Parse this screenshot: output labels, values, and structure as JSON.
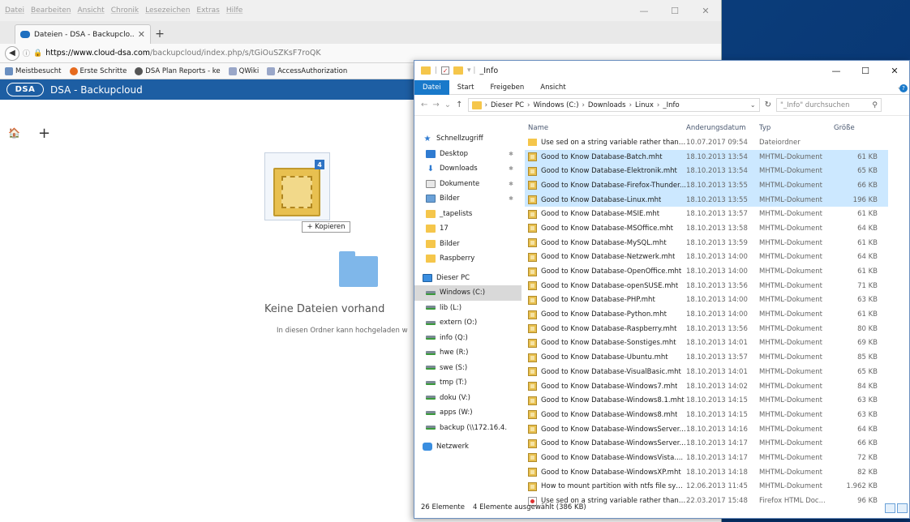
{
  "firefox": {
    "menubar": [
      "Datei",
      "Bearbeiten",
      "Ansicht",
      "Chronik",
      "Lesezeichen",
      "Extras",
      "Hilfe"
    ],
    "tab": {
      "title": "Dateien - DSA - Backupclo..."
    },
    "url": {
      "host_part": "https://www.cloud-dsa.com",
      "rest": "/backupcloud/index.php/s/tGiOuSZKsF7roQK"
    },
    "bookmarks": [
      "Meistbesucht",
      "Erste Schritte",
      "DSA Plan Reports - ke",
      "QWiki",
      "AccessAuthorization"
    ]
  },
  "app": {
    "logo": "DSA",
    "title": "DSA - Backupcloud",
    "drag_badge": "4",
    "copy_tooltip": "+ Kopieren",
    "empty_title": "Keine Dateien vorhand",
    "empty_subtitle": "In diesen Ordner kann hochgeladen w"
  },
  "explorer": {
    "title": "_Info",
    "ribbon_tabs": [
      "Datei",
      "Start",
      "Freigeben",
      "Ansicht"
    ],
    "breadcrumb": [
      "Dieser PC",
      "Windows (C:)",
      "Downloads",
      "Linux",
      "_Info"
    ],
    "search_placeholder": "\"_Info\" durchsuchen",
    "columns": {
      "name": "Name",
      "date": "Änderungsdatum",
      "type": "Typ",
      "size": "Größe"
    },
    "nav": [
      {
        "label": "Schnellzugriff",
        "icon": "star-icon",
        "kind": "group"
      },
      {
        "label": "Desktop",
        "icon": "desktop-icon",
        "kind": "sub",
        "pin": true
      },
      {
        "label": "Downloads",
        "icon": "download-icon",
        "kind": "sub",
        "pin": true
      },
      {
        "label": "Dokumente",
        "icon": "documents-icon",
        "kind": "sub",
        "pin": true
      },
      {
        "label": "Bilder",
        "icon": "pictures-icon",
        "kind": "sub",
        "pin": true
      },
      {
        "label": "_tapelists",
        "icon": "folder-icon",
        "kind": "sub"
      },
      {
        "label": "17",
        "icon": "folder-icon",
        "kind": "sub"
      },
      {
        "label": "Bilder",
        "icon": "folder-icon",
        "kind": "sub"
      },
      {
        "label": "Raspberry",
        "icon": "folder-icon",
        "kind": "sub"
      },
      {
        "label": "Dieser PC",
        "icon": "pc-icon",
        "kind": "group"
      },
      {
        "label": "Windows (C:)",
        "icon": "drive-icon",
        "kind": "sub",
        "selected": true
      },
      {
        "label": "lib (L:)",
        "icon": "drive-icon",
        "kind": "sub"
      },
      {
        "label": "extern (O:)",
        "icon": "drive-icon",
        "kind": "sub"
      },
      {
        "label": "info (Q:)",
        "icon": "drive-icon",
        "kind": "sub"
      },
      {
        "label": "hwe (R:)",
        "icon": "drive-icon",
        "kind": "sub"
      },
      {
        "label": "swe (S:)",
        "icon": "drive-icon",
        "kind": "sub"
      },
      {
        "label": "tmp (T:)",
        "icon": "drive-icon",
        "kind": "sub"
      },
      {
        "label": "doku (V:)",
        "icon": "drive-icon",
        "kind": "sub"
      },
      {
        "label": "apps (W:)",
        "icon": "drive-icon",
        "kind": "sub"
      },
      {
        "label": "backup (\\\\172.16.4.",
        "icon": "drive-icon",
        "kind": "sub"
      },
      {
        "label": "Netzwerk",
        "icon": "network-icon",
        "kind": "group"
      }
    ],
    "files": [
      {
        "name": "Use sed on a string variable rather than a ...",
        "date": "10.07.2017 09:54",
        "type": "Dateiordner",
        "size": "",
        "icon": "folder",
        "selected": false
      },
      {
        "name": "Good to Know Database-Batch.mht",
        "date": "18.10.2013 13:54",
        "type": "MHTML-Dokument",
        "size": "61 KB",
        "icon": "mht",
        "selected": true
      },
      {
        "name": "Good to Know Database-Elektronik.mht",
        "date": "18.10.2013 13:54",
        "type": "MHTML-Dokument",
        "size": "65 KB",
        "icon": "mht",
        "selected": true
      },
      {
        "name": "Good to Know Database-Firefox-Thunder...",
        "date": "18.10.2013 13:55",
        "type": "MHTML-Dokument",
        "size": "66 KB",
        "icon": "mht",
        "selected": true
      },
      {
        "name": "Good to Know Database-Linux.mht",
        "date": "18.10.2013 13:55",
        "type": "MHTML-Dokument",
        "size": "196 KB",
        "icon": "mht",
        "selected": true
      },
      {
        "name": "Good to Know Database-MSIE.mht",
        "date": "18.10.2013 13:57",
        "type": "MHTML-Dokument",
        "size": "61 KB",
        "icon": "mht",
        "selected": false
      },
      {
        "name": "Good to Know Database-MSOffice.mht",
        "date": "18.10.2013 13:58",
        "type": "MHTML-Dokument",
        "size": "64 KB",
        "icon": "mht",
        "selected": false
      },
      {
        "name": "Good to Know Database-MySQL.mht",
        "date": "18.10.2013 13:59",
        "type": "MHTML-Dokument",
        "size": "61 KB",
        "icon": "mht",
        "selected": false
      },
      {
        "name": "Good to Know Database-Netzwerk.mht",
        "date": "18.10.2013 14:00",
        "type": "MHTML-Dokument",
        "size": "64 KB",
        "icon": "mht",
        "selected": false
      },
      {
        "name": "Good to Know Database-OpenOffice.mht",
        "date": "18.10.2013 14:00",
        "type": "MHTML-Dokument",
        "size": "61 KB",
        "icon": "mht",
        "selected": false
      },
      {
        "name": "Good to Know Database-openSUSE.mht",
        "date": "18.10.2013 13:56",
        "type": "MHTML-Dokument",
        "size": "71 KB",
        "icon": "mht",
        "selected": false
      },
      {
        "name": "Good to Know Database-PHP.mht",
        "date": "18.10.2013 14:00",
        "type": "MHTML-Dokument",
        "size": "63 KB",
        "icon": "mht",
        "selected": false
      },
      {
        "name": "Good to Know Database-Python.mht",
        "date": "18.10.2013 14:00",
        "type": "MHTML-Dokument",
        "size": "61 KB",
        "icon": "mht",
        "selected": false
      },
      {
        "name": "Good to Know Database-Raspberry.mht",
        "date": "18.10.2013 13:56",
        "type": "MHTML-Dokument",
        "size": "80 KB",
        "icon": "mht",
        "selected": false
      },
      {
        "name": "Good to Know Database-Sonstiges.mht",
        "date": "18.10.2013 14:01",
        "type": "MHTML-Dokument",
        "size": "69 KB",
        "icon": "mht",
        "selected": false
      },
      {
        "name": "Good to Know Database-Ubuntu.mht",
        "date": "18.10.2013 13:57",
        "type": "MHTML-Dokument",
        "size": "85 KB",
        "icon": "mht",
        "selected": false
      },
      {
        "name": "Good to Know Database-VisualBasic.mht",
        "date": "18.10.2013 14:01",
        "type": "MHTML-Dokument",
        "size": "65 KB",
        "icon": "mht",
        "selected": false
      },
      {
        "name": "Good to Know Database-Windows7.mht",
        "date": "18.10.2013 14:02",
        "type": "MHTML-Dokument",
        "size": "84 KB",
        "icon": "mht",
        "selected": false
      },
      {
        "name": "Good to Know Database-Windows8.1.mht",
        "date": "18.10.2013 14:15",
        "type": "MHTML-Dokument",
        "size": "63 KB",
        "icon": "mht",
        "selected": false
      },
      {
        "name": "Good to Know Database-Windows8.mht",
        "date": "18.10.2013 14:15",
        "type": "MHTML-Dokument",
        "size": "63 KB",
        "icon": "mht",
        "selected": false
      },
      {
        "name": "Good to Know Database-WindowsServer...",
        "date": "18.10.2013 14:16",
        "type": "MHTML-Dokument",
        "size": "64 KB",
        "icon": "mht",
        "selected": false
      },
      {
        "name": "Good to Know Database-WindowsServer...",
        "date": "18.10.2013 14:17",
        "type": "MHTML-Dokument",
        "size": "66 KB",
        "icon": "mht",
        "selected": false
      },
      {
        "name": "Good to Know Database-WindowsVista....",
        "date": "18.10.2013 14:17",
        "type": "MHTML-Dokument",
        "size": "72 KB",
        "icon": "mht",
        "selected": false
      },
      {
        "name": "Good to Know Database-WindowsXP.mht",
        "date": "18.10.2013 14:18",
        "type": "MHTML-Dokument",
        "size": "82 KB",
        "icon": "mht",
        "selected": false
      },
      {
        "name": "How to mount partition with ntfs file syst...",
        "date": "12.06.2013 11:45",
        "type": "MHTML-Dokument",
        "size": "1.962 KB",
        "icon": "mht",
        "selected": false
      },
      {
        "name": "Use sed on a string variable rather than a ...",
        "date": "22.03.2017 15:48",
        "type": "Firefox HTML Doc...",
        "size": "96 KB",
        "icon": "html",
        "selected": false
      }
    ],
    "status": {
      "count": "26 Elemente",
      "selection": "4 Elemente ausgewählt (386 KB)"
    }
  }
}
